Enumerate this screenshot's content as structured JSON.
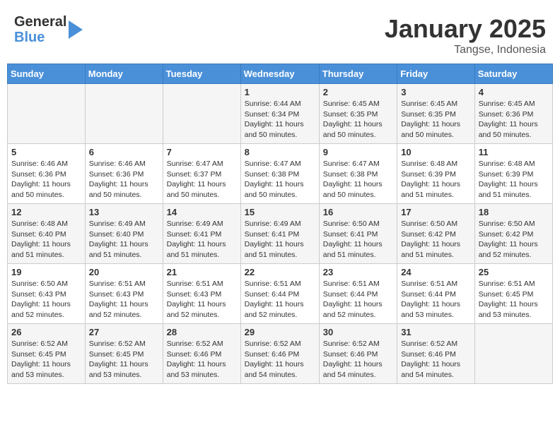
{
  "header": {
    "logo_general": "General",
    "logo_blue": "Blue",
    "month": "January 2025",
    "location": "Tangse, Indonesia"
  },
  "days_of_week": [
    "Sunday",
    "Monday",
    "Tuesday",
    "Wednesday",
    "Thursday",
    "Friday",
    "Saturday"
  ],
  "weeks": [
    [
      {
        "day": "",
        "info": ""
      },
      {
        "day": "",
        "info": ""
      },
      {
        "day": "",
        "info": ""
      },
      {
        "day": "1",
        "info": "Sunrise: 6:44 AM\nSunset: 6:34 PM\nDaylight: 11 hours\nand 50 minutes."
      },
      {
        "day": "2",
        "info": "Sunrise: 6:45 AM\nSunset: 6:35 PM\nDaylight: 11 hours\nand 50 minutes."
      },
      {
        "day": "3",
        "info": "Sunrise: 6:45 AM\nSunset: 6:35 PM\nDaylight: 11 hours\nand 50 minutes."
      },
      {
        "day": "4",
        "info": "Sunrise: 6:45 AM\nSunset: 6:36 PM\nDaylight: 11 hours\nand 50 minutes."
      }
    ],
    [
      {
        "day": "5",
        "info": "Sunrise: 6:46 AM\nSunset: 6:36 PM\nDaylight: 11 hours\nand 50 minutes."
      },
      {
        "day": "6",
        "info": "Sunrise: 6:46 AM\nSunset: 6:36 PM\nDaylight: 11 hours\nand 50 minutes."
      },
      {
        "day": "7",
        "info": "Sunrise: 6:47 AM\nSunset: 6:37 PM\nDaylight: 11 hours\nand 50 minutes."
      },
      {
        "day": "8",
        "info": "Sunrise: 6:47 AM\nSunset: 6:38 PM\nDaylight: 11 hours\nand 50 minutes."
      },
      {
        "day": "9",
        "info": "Sunrise: 6:47 AM\nSunset: 6:38 PM\nDaylight: 11 hours\nand 50 minutes."
      },
      {
        "day": "10",
        "info": "Sunrise: 6:48 AM\nSunset: 6:39 PM\nDaylight: 11 hours\nand 51 minutes."
      },
      {
        "day": "11",
        "info": "Sunrise: 6:48 AM\nSunset: 6:39 PM\nDaylight: 11 hours\nand 51 minutes."
      }
    ],
    [
      {
        "day": "12",
        "info": "Sunrise: 6:48 AM\nSunset: 6:40 PM\nDaylight: 11 hours\nand 51 minutes."
      },
      {
        "day": "13",
        "info": "Sunrise: 6:49 AM\nSunset: 6:40 PM\nDaylight: 11 hours\nand 51 minutes."
      },
      {
        "day": "14",
        "info": "Sunrise: 6:49 AM\nSunset: 6:41 PM\nDaylight: 11 hours\nand 51 minutes."
      },
      {
        "day": "15",
        "info": "Sunrise: 6:49 AM\nSunset: 6:41 PM\nDaylight: 11 hours\nand 51 minutes."
      },
      {
        "day": "16",
        "info": "Sunrise: 6:50 AM\nSunset: 6:41 PM\nDaylight: 11 hours\nand 51 minutes."
      },
      {
        "day": "17",
        "info": "Sunrise: 6:50 AM\nSunset: 6:42 PM\nDaylight: 11 hours\nand 51 minutes."
      },
      {
        "day": "18",
        "info": "Sunrise: 6:50 AM\nSunset: 6:42 PM\nDaylight: 11 hours\nand 52 minutes."
      }
    ],
    [
      {
        "day": "19",
        "info": "Sunrise: 6:50 AM\nSunset: 6:43 PM\nDaylight: 11 hours\nand 52 minutes."
      },
      {
        "day": "20",
        "info": "Sunrise: 6:51 AM\nSunset: 6:43 PM\nDaylight: 11 hours\nand 52 minutes."
      },
      {
        "day": "21",
        "info": "Sunrise: 6:51 AM\nSunset: 6:43 PM\nDaylight: 11 hours\nand 52 minutes."
      },
      {
        "day": "22",
        "info": "Sunrise: 6:51 AM\nSunset: 6:44 PM\nDaylight: 11 hours\nand 52 minutes."
      },
      {
        "day": "23",
        "info": "Sunrise: 6:51 AM\nSunset: 6:44 PM\nDaylight: 11 hours\nand 52 minutes."
      },
      {
        "day": "24",
        "info": "Sunrise: 6:51 AM\nSunset: 6:44 PM\nDaylight: 11 hours\nand 53 minutes."
      },
      {
        "day": "25",
        "info": "Sunrise: 6:51 AM\nSunset: 6:45 PM\nDaylight: 11 hours\nand 53 minutes."
      }
    ],
    [
      {
        "day": "26",
        "info": "Sunrise: 6:52 AM\nSunset: 6:45 PM\nDaylight: 11 hours\nand 53 minutes."
      },
      {
        "day": "27",
        "info": "Sunrise: 6:52 AM\nSunset: 6:45 PM\nDaylight: 11 hours\nand 53 minutes."
      },
      {
        "day": "28",
        "info": "Sunrise: 6:52 AM\nSunset: 6:46 PM\nDaylight: 11 hours\nand 53 minutes."
      },
      {
        "day": "29",
        "info": "Sunrise: 6:52 AM\nSunset: 6:46 PM\nDaylight: 11 hours\nand 54 minutes."
      },
      {
        "day": "30",
        "info": "Sunrise: 6:52 AM\nSunset: 6:46 PM\nDaylight: 11 hours\nand 54 minutes."
      },
      {
        "day": "31",
        "info": "Sunrise: 6:52 AM\nSunset: 6:46 PM\nDaylight: 11 hours\nand 54 minutes."
      },
      {
        "day": "",
        "info": ""
      }
    ]
  ]
}
